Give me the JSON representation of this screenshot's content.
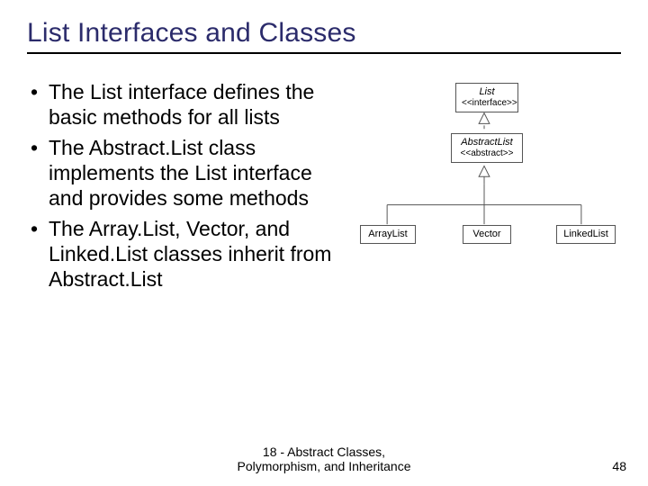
{
  "title": "List Interfaces and Classes",
  "bullets": {
    "items": [
      "The List interface defines the basic methods for all lists",
      "The Abstract.List class implements the List interface and provides some methods",
      "The Array.List, Vector, and Linked.List classes inherit from Abstract.List"
    ]
  },
  "diagram": {
    "list": {
      "name": "List",
      "stereo": "<<interface>>"
    },
    "abstractlist": {
      "name": "AbstractList",
      "stereo": "<<abstract>>"
    },
    "arraylist": {
      "name": "ArrayList"
    },
    "vector": {
      "name": "Vector"
    },
    "linkedlist": {
      "name": "LinkedList"
    }
  },
  "footer": {
    "line1": "18 - Abstract Classes,",
    "line2": "Polymorphism, and Inheritance"
  },
  "page_number": "48",
  "chart_data": {
    "type": "diagram",
    "nodes": [
      {
        "id": "List",
        "stereotype": "interface"
      },
      {
        "id": "AbstractList",
        "stereotype": "abstract"
      },
      {
        "id": "ArrayList"
      },
      {
        "id": "Vector"
      },
      {
        "id": "LinkedList"
      }
    ],
    "edges": [
      {
        "from": "AbstractList",
        "to": "List",
        "relation": "realizes"
      },
      {
        "from": "ArrayList",
        "to": "AbstractList",
        "relation": "inherits"
      },
      {
        "from": "Vector",
        "to": "AbstractList",
        "relation": "inherits"
      },
      {
        "from": "LinkedList",
        "to": "AbstractList",
        "relation": "inherits"
      }
    ]
  }
}
